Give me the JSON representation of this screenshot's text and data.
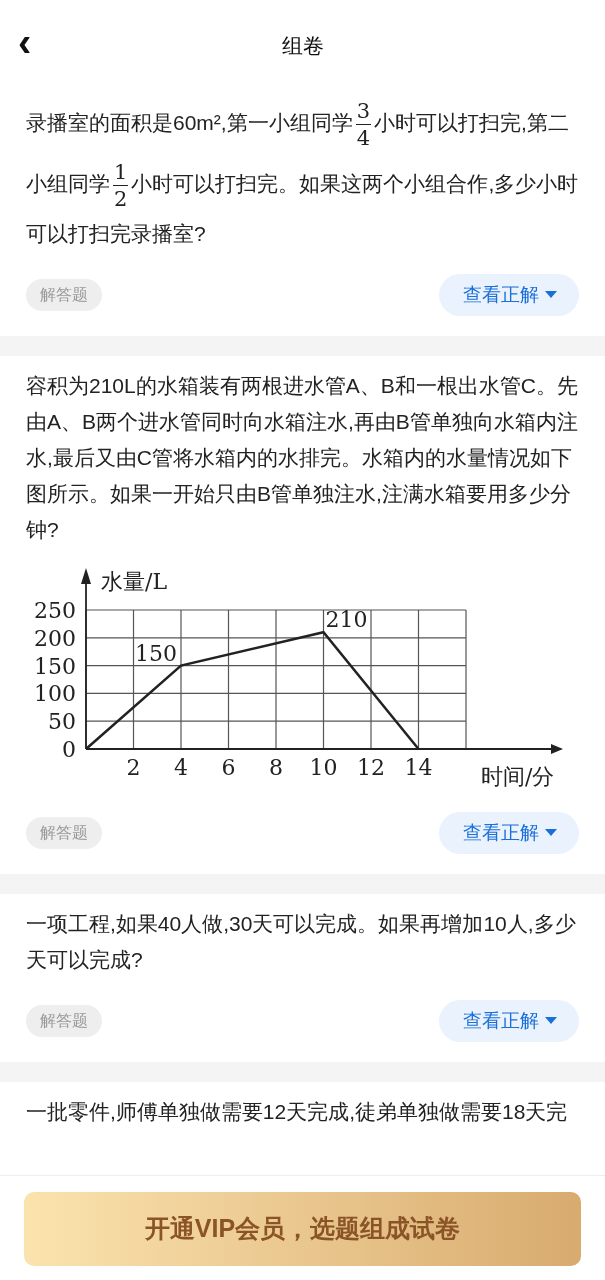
{
  "header": {
    "back": "‹",
    "title": "组卷"
  },
  "questions": [
    {
      "parts": [
        {
          "kind": "text",
          "text": "录播室的面积是60m²,第一小组同学"
        },
        {
          "kind": "fraction",
          "numerator": "3",
          "denominator": "4"
        },
        {
          "kind": "text",
          "text": "小时可以打扫完,第二小组同学"
        },
        {
          "kind": "fraction",
          "numerator": "1",
          "denominator": "2"
        },
        {
          "kind": "text",
          "text": "小时可以打扫完。如果这两个小组合作,多少小时可以打扫完录播室?"
        }
      ],
      "tag": "解答题",
      "button": "查看正解"
    },
    {
      "parts": [
        {
          "kind": "text",
          "text": "容积为210L的水箱装有两根进水管A、B和一根出水管C。先由A、B两个进水管同时向水箱注水,再由B管单独向水箱内注水,最后又由C管将水箱内的水排完。水箱内的水量情况如下图所示。如果一开始只由B管单独注水,注满水箱要用多少分钟?"
        }
      ],
      "chart_data": {
        "type": "line",
        "xlabel": "时间/分",
        "ylabel": "水量/L",
        "x": [
          0,
          4,
          10,
          14
        ],
        "series": [
          {
            "color": "#222222",
            "values": [
              0,
              150,
              210,
              0
            ]
          }
        ],
        "xlim": [
          0,
          20
        ],
        "grid": true,
        "ylim": [
          0,
          250
        ],
        "xticks": [
          2,
          4,
          6,
          8,
          10,
          12,
          14
        ],
        "yticks": [
          0,
          50,
          100,
          150,
          200,
          250
        ],
        "annotations": [
          {
            "x": 4,
            "y": 150,
            "text": "150"
          },
          {
            "x": 10,
            "y": 210,
            "text": "210"
          }
        ]
      },
      "tag": "解答题",
      "button": "查看正解"
    },
    {
      "parts": [
        {
          "kind": "text",
          "text": "一项工程,如果40人做,30天可以完成。如果再增加10人,多少天可以完成?"
        }
      ],
      "tag": "解答题",
      "button": "查看正解"
    },
    {
      "parts": [
        {
          "kind": "text",
          "text": "一批零件,师傅单独做需要12天完成,徒弟单独做需要18天完"
        }
      ]
    }
  ],
  "vip_button": "开通VIP会员，选题组成试卷"
}
